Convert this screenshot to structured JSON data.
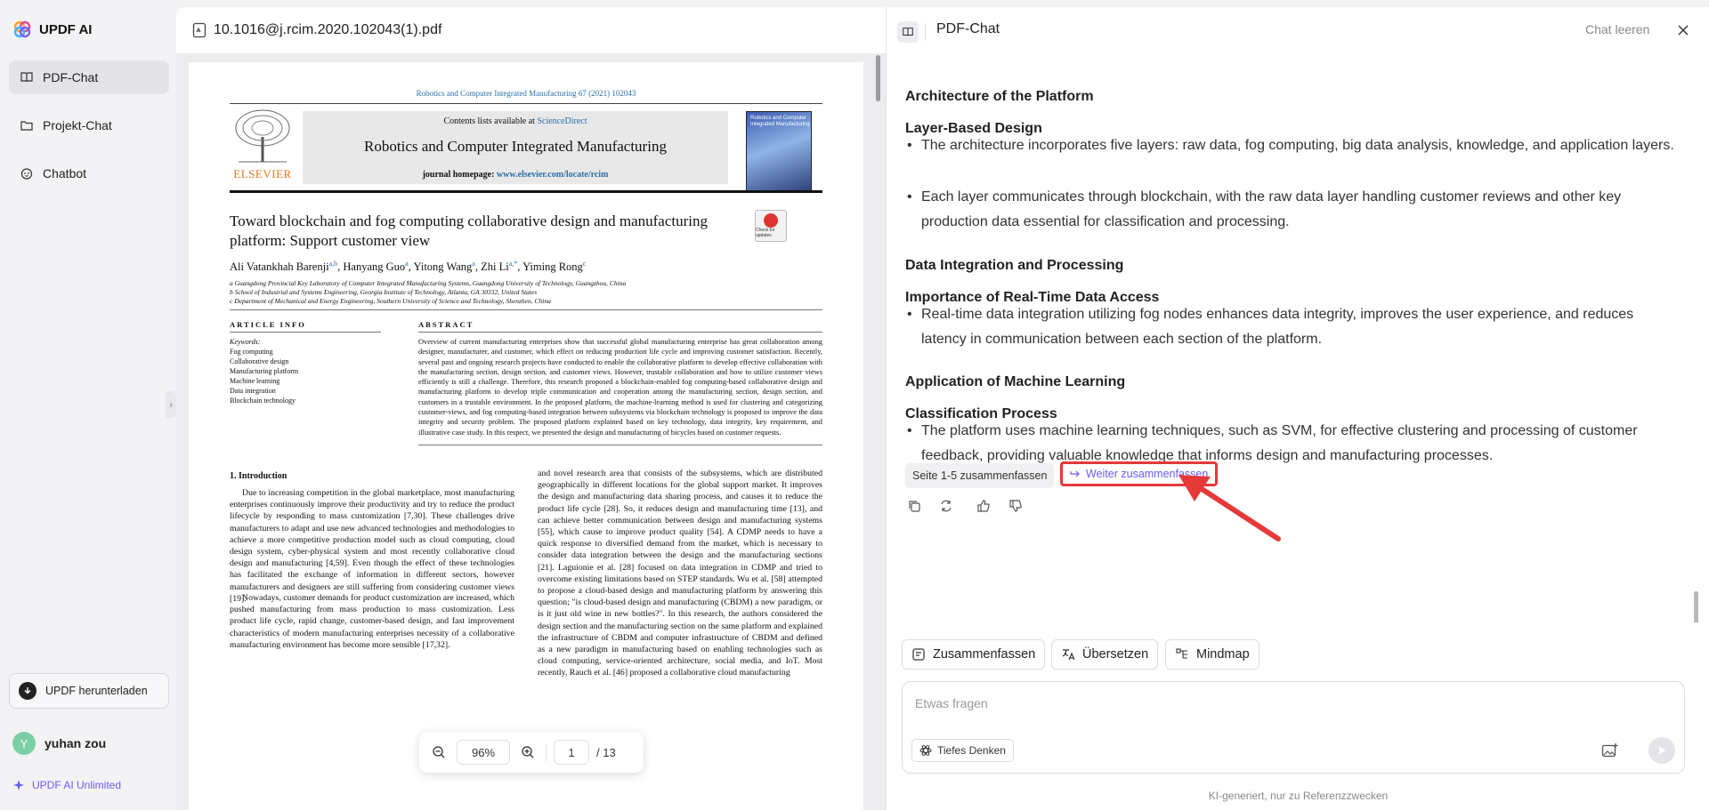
{
  "app": {
    "name": "UPDF AI",
    "colors": {
      "accent": "#6b5bf0",
      "highlight_border": "#e5393a",
      "sidebar_bg": "#f3f3f5"
    }
  },
  "sidebar": {
    "items": [
      {
        "label": "PDF-Chat",
        "icon": "book-icon",
        "active": true
      },
      {
        "label": "Projekt-Chat",
        "icon": "folder-icon",
        "active": false
      },
      {
        "label": "Chatbot",
        "icon": "bot-icon",
        "active": false
      }
    ],
    "download_label": "UPDF herunterladen",
    "user": {
      "initial": "Y",
      "name": "yuhan zou"
    },
    "unlimited_label": "UPDF AI Unlimited"
  },
  "pdf": {
    "filename": "10.1016@j.rcim.2020.102043(1).pdf",
    "page": {
      "journal_ref": "Robotics and Computer Integrated Manufacturing 67 (2021) 102043",
      "contents_prefix": "Contents lists available at ",
      "contents_link": "ScienceDirect",
      "journal_name": "Robotics and Computer Integrated Manufacturing",
      "homepage_prefix": "journal homepage: ",
      "homepage_url": "www.elsevier.com/locate/rcim",
      "publisher": "ELSEVIER",
      "cover_text": "Robotics and Computer Integrated Manufacturing",
      "check_updates": "Check for updates",
      "title": "Toward blockchain and fog computing collaborative design and manufacturing platform: Support customer view",
      "authors": [
        {
          "name": "Ali Vatankhah Barenji",
          "sup": "a,b"
        },
        {
          "name": "Hanyang Guo",
          "sup": "a"
        },
        {
          "name": "Yitong Wang",
          "sup": "a"
        },
        {
          "name": "Zhi Li",
          "sup": "a,*"
        },
        {
          "name": "Yiming Rong",
          "sup": "c"
        }
      ],
      "affiliations": [
        "a Guangdong Provincial Key Laboratory of Computer Integrated Manufacturing Systems, Guangdong University of Technology, Guangzhou, China",
        "b School of Industrial and Systems Engineering, Georgia Institute of Technology, Atlanta, GA 30332, United States",
        "c Department of Mechanical and Energy Engineering, Southern University of Science and Technology, Shenzhen, China"
      ],
      "article_info_label": "ARTICLE INFO",
      "abstract_label": "ABSTRACT",
      "keywords_label": "Keywords:",
      "keywords": [
        "Fog computing",
        "Collaborative design",
        "Manufacturing platform",
        "Machine learning",
        "Data integration",
        "Blockchain technology"
      ],
      "abstract": "Overview of current manufacturing enterprises show that successful global manufacturing enterprise has great collaboration among designer, manufacturer, and customer, which effect on reducing production life cycle and improving customer satisfaction. Recently, several past and ongoing research projects have conducted to enable the collaborative platform to develop effective collaboration with the manufacturing section, design section, and customer views. However, trustable collaboration and how to utilize customer views efficiently is still a challenge. Therefore, this research proposed a blockchain-enabled fog computing-based collaborative design and manufacturing platform to develop triple communication and cooperation among the manufacturing section, design section, and customers in a trustable environment. In the proposed platform, the machine-learning method is used for clustering and categorizing customer-views, and fog computing-based integration between subsystems via blockchain technology is proposed to improve the data integrity and security problem. The proposed platform explained based on key technology, data integrity, key requirement, and illustrative case study. In this respect, we presented the design and manufacturing of bicycles based on customer requests.",
      "intro_heading": "1. Introduction",
      "intro_left": "Due to increasing competition in the global marketplace, most manufacturing enterprises continuously improve their productivity and try to reduce the product lifecycle by responding to mass customization [7,30]. These challenges drive manufacturers to adapt and use new advanced technologies and methodologies to achieve a more competitive production model such as cloud computing, cloud design system, cyber-physical system and most recently collaborative cloud design and manufacturing [4,59]. Even though the effect of these technologies has facilitated the exchange of information in different sectors, however manufacturers and designers are still suffering from considering customer views [19].",
      "intro_left2": "Nowadays, customer demands for product customization are increased, which pushed manufacturing from mass production to mass customization. Less product life cycle, rapid change, customer-based design, and fast improvement characteristics of modern manufacturing enterprises necessity of a collaborative manufacturing environment has become more sensible [17,32].",
      "intro_right": "and novel research area that consists of the subsystems, which are distributed geographically in different locations for the global support market. It improves the design and manufacturing data sharing process, and causes it to reduce the product life cycle [28]. So, it reduces design and manufacturing time [13], and can achieve better communication between design and manufacturing systems [55], which cause to improve product quality [54]. A CDMP needs to have a quick response to diversified demand from the market, which is necessary to consider data integration between the design and the manufacturing sections [21]. Laguionie et al. [28] focused on data integration in CDMP and tried to overcome existing limitations based on STEP standards. Wu et al. [58] attempted to propose a cloud-based design and manufacturing platform by answering this question; \"is cloud-based design and manufacturing (CBDM) a new paradigm, or is it just old wine in new bottles?\". In this research, the authors considered the design section and the manufacturing section on the same platform and explained the infrastructure of CBDM and computer infrastructure of CBDM and defined as a new paradigm in manufacturing based on enabling technologies such as cloud computing, service-oriented architecture, social media, and IoT. Most recently, Rauch et al. [46] proposed a collaborative cloud manufacturing"
    },
    "toolbar": {
      "zoom": "96%",
      "current_page": "1",
      "total_pages": "/ 13"
    }
  },
  "chat": {
    "title": "PDF-Chat",
    "clear_label": "Chat leeren",
    "content": [
      {
        "type": "heading",
        "text": "Architecture of the Platform"
      },
      {
        "type": "heading",
        "text": "Layer-Based Design"
      },
      {
        "type": "bullet",
        "text": "The architecture incorporates five layers: raw data, fog computing, big data analysis, knowledge, and application layers."
      },
      {
        "type": "bullet",
        "text": "Each layer communicates through blockchain, with the raw data layer handling customer reviews and other key production data essential for classification and processing."
      },
      {
        "type": "heading",
        "text": "Data Integration and Processing"
      },
      {
        "type": "heading",
        "text": "Importance of Real-Time Data Access"
      },
      {
        "type": "bullet",
        "text": "Real-time data integration utilizing fog nodes enhances data integrity, improves the user experience, and reduces latency in communication between each section of the platform."
      },
      {
        "type": "heading",
        "text": "Application of Machine Learning"
      },
      {
        "type": "heading",
        "text": "Classification Process"
      },
      {
        "type": "bullet",
        "text": "The platform uses machine learning techniques, such as SVM, for effective clustering and processing of customer feedback, providing valuable knowledge that informs design and manufacturing processes."
      }
    ],
    "chips": {
      "summarize_pages": "Seite 1-5 zusammenfassen",
      "continue_summary": "Weiter zusammenfassen"
    },
    "tools": {
      "summarize": "Zusammenfassen",
      "translate": "Übersetzen",
      "mindmap": "Mindmap"
    },
    "input": {
      "placeholder": "Etwas fragen",
      "deep_think_label": "Tiefes Denken"
    },
    "disclaimer": "KI-generiert, nur zu Referenzzwecken"
  }
}
